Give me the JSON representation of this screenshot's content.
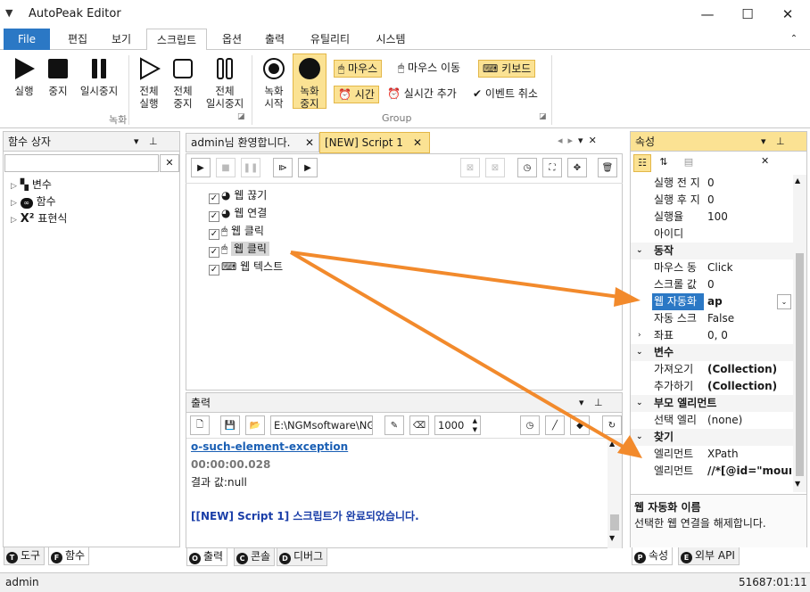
{
  "app": {
    "title": "AutoPeak Editor"
  },
  "window_controls": {
    "minimize": "—",
    "maximize": "☐",
    "close": "✕"
  },
  "ribbon_tabs": [
    "File",
    "편집",
    "보기",
    "스크립트",
    "옵션",
    "출력",
    "유틸리티",
    "시스템"
  ],
  "ribbon": {
    "record_group": {
      "label": "녹화",
      "run": "실행",
      "stop": "중지",
      "pause": "일시중지",
      "run_all": "전체\n실행",
      "stop_all": "전체\n중지",
      "pause_all": "전체\n일시중지"
    },
    "group": {
      "label": "Group",
      "rec_start": "녹화\n시작",
      "rec_stop": "녹화\n중지",
      "mouse": "마우스",
      "mouse_move": "마우스 이동",
      "keyboard": "키보드",
      "time": "시간",
      "add_realtime": "실시간 추가",
      "cancel_event": "이벤트 취소"
    }
  },
  "function_box": {
    "title": "함수 상자",
    "search_value": "",
    "items": [
      "변수",
      "함수",
      "표현식"
    ],
    "tabs": [
      "도구",
      "함수"
    ]
  },
  "editor": {
    "tabs": [
      "admin님 환영합니다.",
      "[NEW] Script 1"
    ],
    "items": [
      "웹 끊기",
      "웹 연결",
      "웹 클릭",
      "웹 클릭",
      "웹 텍스트"
    ]
  },
  "output": {
    "title": "출력",
    "path": "E:\\NGMsoftware\\NG",
    "count": "1000",
    "lines": [
      {
        "text": "o-such-element-exception",
        "style": "link"
      },
      {
        "text": "00:00:00.028",
        "style": "gray"
      },
      {
        "text": "결과 값:null",
        "style": "normal"
      },
      {
        "text": "",
        "style": "normal"
      },
      {
        "text": "[[NEW] Script 1] 스크립트가 완료되었습니다.",
        "style": "blue"
      }
    ],
    "tabs": [
      "출력",
      "콘솔",
      "디버그"
    ]
  },
  "properties": {
    "title": "속성",
    "rows": [
      {
        "type": "row",
        "k": "실행 전 지",
        "v": "0"
      },
      {
        "type": "row",
        "k": "실행 후 지",
        "v": "0"
      },
      {
        "type": "row",
        "k": "실행율",
        "v": "100"
      },
      {
        "type": "row",
        "k": "아이디",
        "v": ""
      },
      {
        "type": "cat",
        "k": "동작"
      },
      {
        "type": "row",
        "k": "마우스 동",
        "v": "Click"
      },
      {
        "type": "row",
        "k": "스크롤 값",
        "v": "0"
      },
      {
        "type": "row",
        "k": "웹 자동화",
        "v": "ap",
        "selected": true
      },
      {
        "type": "row",
        "k": "자동 스크",
        "v": "False"
      },
      {
        "type": "row",
        "k": "좌표",
        "v": "0, 0",
        "expand": true
      },
      {
        "type": "cat",
        "k": "변수"
      },
      {
        "type": "row",
        "k": "가져오기",
        "v": "(Collection)",
        "bold": true
      },
      {
        "type": "row",
        "k": "추가하기",
        "v": "(Collection)",
        "bold": true
      },
      {
        "type": "cat",
        "k": "부모 엘리먼트"
      },
      {
        "type": "row",
        "k": "선택 엘리",
        "v": "(none)"
      },
      {
        "type": "cat",
        "k": "찾기"
      },
      {
        "type": "row",
        "k": "엘리먼트",
        "v": "XPath"
      },
      {
        "type": "row",
        "k": "엘리먼트",
        "v": "//*[@id=\"mount",
        "bold": true
      }
    ],
    "desc_title": "웹 자동화 이름",
    "desc_text": "선택한 웹 연결을 해제합니다.",
    "tabs": [
      "속성",
      "외부 API"
    ]
  },
  "status": {
    "user": "admin",
    "time": "51687:01:11"
  },
  "colors": {
    "file_tab": "#2b78c5",
    "highlight": "#fbe293",
    "arrow": "#f28a2c",
    "link": "#1a5fb4"
  }
}
